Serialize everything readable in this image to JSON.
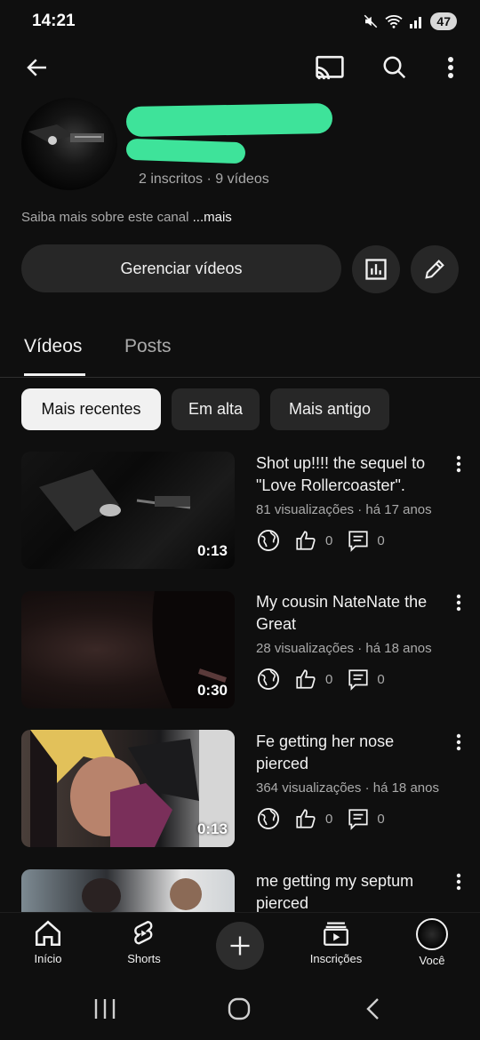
{
  "status": {
    "time": "14:21",
    "battery": "47"
  },
  "header": {
    "back_icon": "arrow-left-icon",
    "cast_icon": "cast-icon",
    "search_icon": "search-icon",
    "more_icon": "more-vertical-icon"
  },
  "channel": {
    "stats": "2 inscritos · 9 vídeos",
    "about_text": "Saiba mais sobre este canal ",
    "about_more": "...mais"
  },
  "actions": {
    "manage_label": "Gerenciar vídeos",
    "analytics_icon": "analytics-icon",
    "edit_icon": "pencil-icon"
  },
  "tabs": [
    {
      "label": "Vídeos",
      "active": true
    },
    {
      "label": "Posts",
      "active": false
    }
  ],
  "chips": [
    {
      "label": "Mais recentes",
      "active": true
    },
    {
      "label": "Em alta",
      "active": false
    },
    {
      "label": "Mais antigo",
      "active": false
    }
  ],
  "videos": [
    {
      "title": "Shot up!!!! the sequel to \"Love Rollercoaster\".",
      "meta": "81 visualizações · há 17 anos",
      "duration": "0:13",
      "likes": "0",
      "comments": "0"
    },
    {
      "title": "My cousin NateNate the Great",
      "meta": "28 visualizações · há 18 anos",
      "duration": "0:30",
      "likes": "0",
      "comments": "0"
    },
    {
      "title": "Fe getting her nose pierced",
      "meta": "364 visualizações · há 18 anos",
      "duration": "0:13",
      "likes": "0",
      "comments": "0"
    },
    {
      "title": "me getting my septum pierced",
      "meta": "",
      "duration": "",
      "likes": "",
      "comments": ""
    }
  ],
  "bottom_nav": [
    {
      "label": "Início",
      "icon": "home-icon"
    },
    {
      "label": "Shorts",
      "icon": "shorts-icon"
    },
    {
      "label": "",
      "icon": "create-icon"
    },
    {
      "label": "Inscrições",
      "icon": "subscriptions-icon"
    },
    {
      "label": "Você",
      "icon": "avatar-icon"
    }
  ],
  "colors": {
    "background": "#0f0f0f",
    "surface": "#272727",
    "redaction": "#3ee39a",
    "secondary_text": "#aaaaaa"
  }
}
